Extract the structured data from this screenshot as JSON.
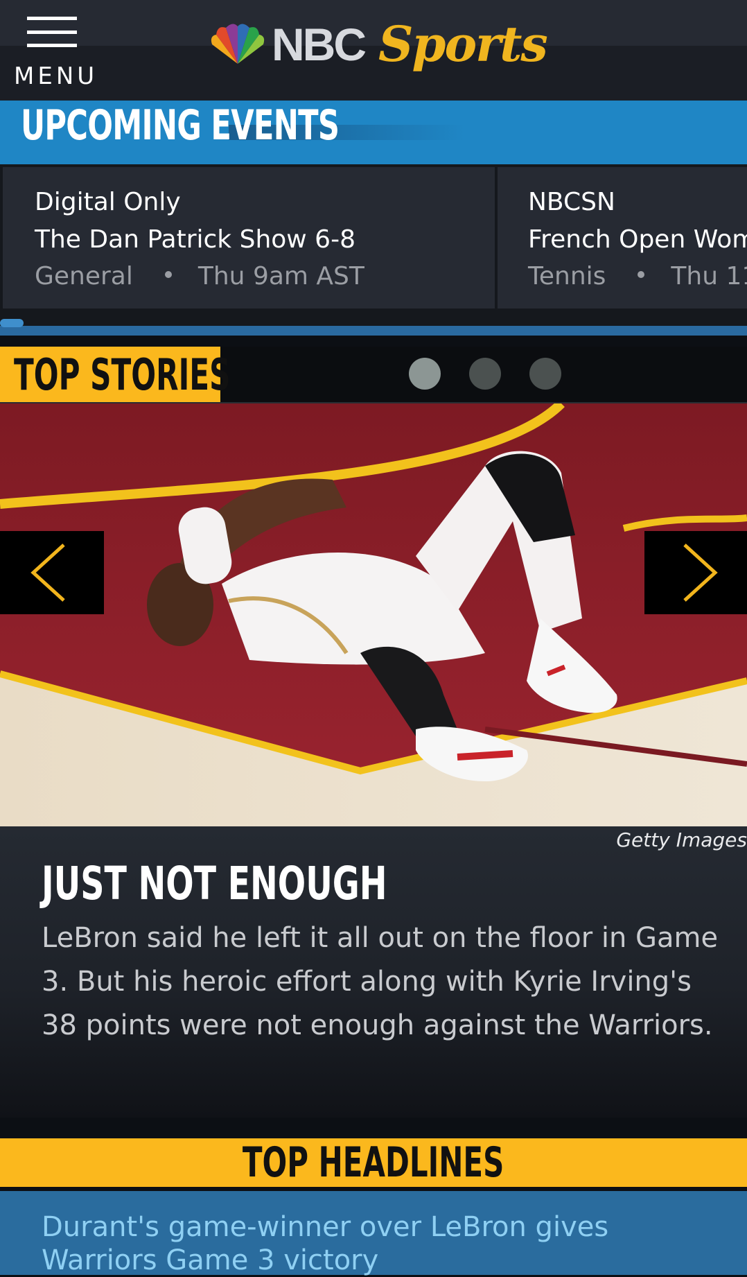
{
  "header": {
    "menu_label": "MENU",
    "logo_nbc": "NBC",
    "logo_sports": "Sports"
  },
  "upcoming": {
    "title": "UPCOMING EVENTS",
    "events": [
      {
        "channel": "Digital Only",
        "title": "The Dan Patrick Show 6-8",
        "category": "General",
        "time": "Thu 9am AST"
      },
      {
        "channel": "NBCSN",
        "title": "French Open Wom",
        "category": "Tennis",
        "time": "Thu 11"
      }
    ]
  },
  "top_stories": {
    "title": "TOP STORIES",
    "pager_count": 3,
    "active_index": 0,
    "image_credit": "Getty Images",
    "headline": "JUST NOT ENOUGH",
    "body": "LeBron said he left it all out on the floor in Game 3. But his heroic effort along with Kyrie Irving's 38 points were not enough against the Warriors."
  },
  "top_headlines": {
    "title": "TOP HEADLINES",
    "items": [
      {
        "text": "Durant's game-winner over LeBron gives Warriors Game 3 victory"
      }
    ]
  },
  "colors": {
    "accent_blue": "#1f86c5",
    "accent_gold": "#fbb81d",
    "header_bg": "#1b1e25"
  }
}
